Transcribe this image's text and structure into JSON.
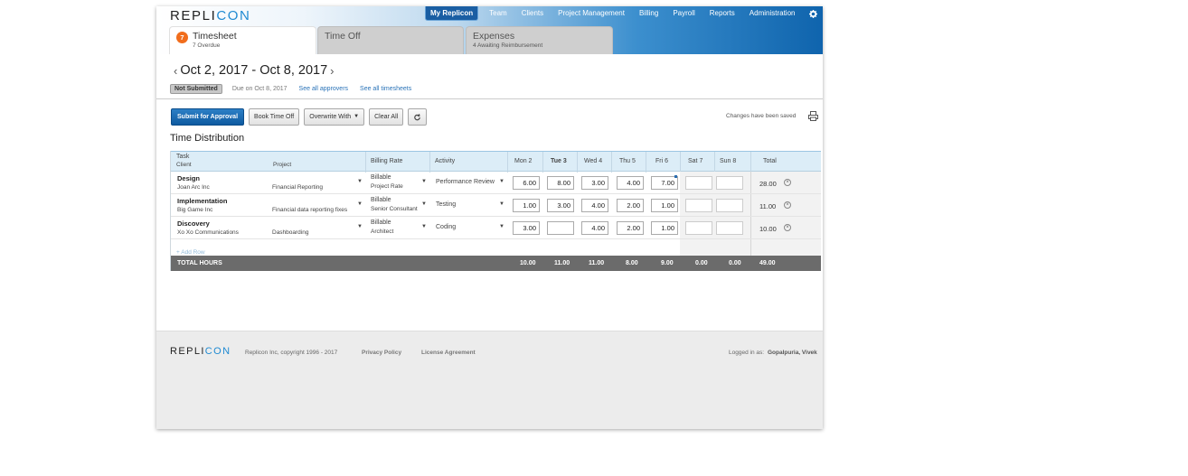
{
  "brand": {
    "logo_prefix": "REPLI",
    "logo_suffix": "CON"
  },
  "nav": {
    "items": [
      "My Replicon",
      "Team",
      "Clients",
      "Project Management",
      "Billing",
      "Payroll",
      "Reports",
      "Administration"
    ],
    "active": "My Replicon",
    "settings_icon": "gear-icon"
  },
  "tabs": [
    {
      "title": "Timesheet",
      "subtitle": "7 Overdue",
      "badge": "7",
      "active": true
    },
    {
      "title": "Time Off",
      "subtitle": "",
      "active": false
    },
    {
      "title": "Expenses",
      "subtitle": "4 Awaiting Reimbursement",
      "active": false
    }
  ],
  "period": {
    "label": "Oct 2, 2017 - Oct 8, 2017",
    "prev_icon": "chevron-left-icon",
    "next_icon": "chevron-right-icon"
  },
  "status": {
    "badge": "Not Submitted",
    "due": "Due on Oct 8, 2017",
    "approvers_link": "See all approvers",
    "timesheets_link": "See all timesheets"
  },
  "toolbar": {
    "submit": "Submit for Approval",
    "book_time_off": "Book Time Off",
    "overwrite": "Overwrite With",
    "clear_all": "Clear All",
    "refresh_icon": "refresh-icon",
    "saved_msg": "Changes have been saved",
    "print_icon": "print-icon"
  },
  "section_title": "Time Distribution",
  "grid": {
    "headers": {
      "task": "Task",
      "client": "Client",
      "project": "Project",
      "billing_rate": "Billing Rate",
      "activity": "Activity",
      "days": [
        "Mon 2",
        "Tue 3",
        "Wed 4",
        "Thu 5",
        "Fri 6",
        "Sat 7",
        "Sun 8"
      ],
      "total": "Total"
    },
    "rows": [
      {
        "task": "Design",
        "client": "Joan Arc Inc",
        "project": "Financial Reporting",
        "billing": "Billable",
        "rate": "Project Rate",
        "activity": "Performance Review",
        "hours": [
          "6.00",
          "8.00",
          "3.00",
          "4.00",
          "7.00",
          "",
          ""
        ],
        "total": "28.00"
      },
      {
        "task": "Implementation",
        "client": "Big Game Inc",
        "project": "Financial data reporting fixes",
        "billing": "Billable",
        "rate": "Senior Consultant",
        "activity": "Testing",
        "hours": [
          "1.00",
          "3.00",
          "4.00",
          "2.00",
          "1.00",
          "",
          ""
        ],
        "total": "11.00"
      },
      {
        "task": "Discovery",
        "client": "Xo Xo Communications",
        "project": "Dashboarding",
        "billing": "Billable",
        "rate": "Architect",
        "activity": "Coding",
        "hours": [
          "3.00",
          "",
          "4.00",
          "2.00",
          "1.00",
          "",
          ""
        ],
        "total": "10.00"
      }
    ],
    "add_row": "+ Add Row",
    "totals": {
      "label": "TOTAL HOURS",
      "days": [
        "10.00",
        "11.00",
        "11.00",
        "8.00",
        "9.00",
        "0.00",
        "0.00"
      ],
      "grand": "49.00"
    }
  },
  "footer": {
    "copyright": "Replicon Inc, copyright 1996 - 2017",
    "privacy": "Privacy Policy",
    "license": "License Agreement",
    "logged_in_label": "Logged in as:",
    "user": "Gopalpuria, Vivek"
  }
}
